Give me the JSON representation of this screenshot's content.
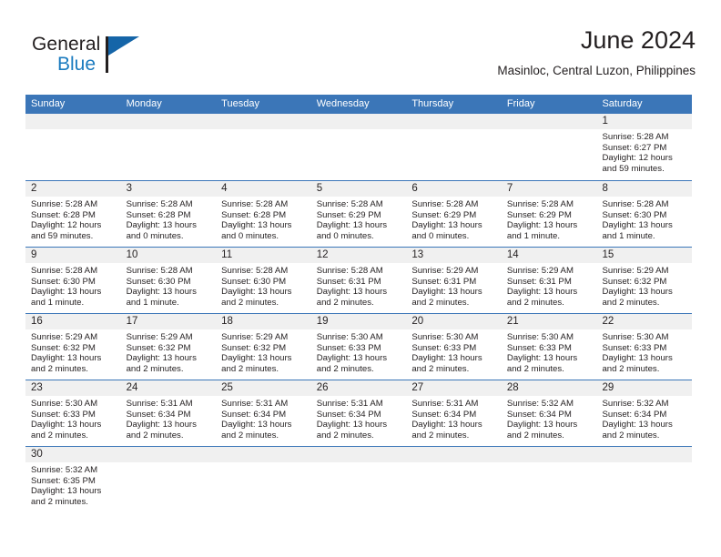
{
  "brand": {
    "name_top": "General",
    "name_bottom": "Blue",
    "accent_color": "#1b7bbf",
    "flag_color": "#1565a8"
  },
  "header": {
    "title": "June 2024",
    "subtitle": "Masinloc, Central Luzon, Philippines"
  },
  "theme": {
    "header_blue": "#3b76b8",
    "day_strip_gray": "#f0f0f0",
    "text_color": "#231f20"
  },
  "calendar": {
    "day_names": [
      "Sunday",
      "Monday",
      "Tuesday",
      "Wednesday",
      "Thursday",
      "Friday",
      "Saturday"
    ],
    "weeks": [
      [
        {
          "day": "",
          "lines": [],
          "empty": true
        },
        {
          "day": "",
          "lines": [],
          "empty": true
        },
        {
          "day": "",
          "lines": [],
          "empty": true
        },
        {
          "day": "",
          "lines": [],
          "empty": true
        },
        {
          "day": "",
          "lines": [],
          "empty": true
        },
        {
          "day": "",
          "lines": [],
          "empty": true
        },
        {
          "day": "1",
          "lines": [
            "Sunrise: 5:28 AM",
            "Sunset: 6:27 PM",
            "Daylight: 12 hours",
            "and 59 minutes."
          ],
          "empty": false
        }
      ],
      [
        {
          "day": "2",
          "lines": [
            "Sunrise: 5:28 AM",
            "Sunset: 6:28 PM",
            "Daylight: 12 hours",
            "and 59 minutes."
          ],
          "empty": false
        },
        {
          "day": "3",
          "lines": [
            "Sunrise: 5:28 AM",
            "Sunset: 6:28 PM",
            "Daylight: 13 hours",
            "and 0 minutes."
          ],
          "empty": false
        },
        {
          "day": "4",
          "lines": [
            "Sunrise: 5:28 AM",
            "Sunset: 6:28 PM",
            "Daylight: 13 hours",
            "and 0 minutes."
          ],
          "empty": false
        },
        {
          "day": "5",
          "lines": [
            "Sunrise: 5:28 AM",
            "Sunset: 6:29 PM",
            "Daylight: 13 hours",
            "and 0 minutes."
          ],
          "empty": false
        },
        {
          "day": "6",
          "lines": [
            "Sunrise: 5:28 AM",
            "Sunset: 6:29 PM",
            "Daylight: 13 hours",
            "and 0 minutes."
          ],
          "empty": false
        },
        {
          "day": "7",
          "lines": [
            "Sunrise: 5:28 AM",
            "Sunset: 6:29 PM",
            "Daylight: 13 hours",
            "and 1 minute."
          ],
          "empty": false
        },
        {
          "day": "8",
          "lines": [
            "Sunrise: 5:28 AM",
            "Sunset: 6:30 PM",
            "Daylight: 13 hours",
            "and 1 minute."
          ],
          "empty": false
        }
      ],
      [
        {
          "day": "9",
          "lines": [
            "Sunrise: 5:28 AM",
            "Sunset: 6:30 PM",
            "Daylight: 13 hours",
            "and 1 minute."
          ],
          "empty": false
        },
        {
          "day": "10",
          "lines": [
            "Sunrise: 5:28 AM",
            "Sunset: 6:30 PM",
            "Daylight: 13 hours",
            "and 1 minute."
          ],
          "empty": false
        },
        {
          "day": "11",
          "lines": [
            "Sunrise: 5:28 AM",
            "Sunset: 6:30 PM",
            "Daylight: 13 hours",
            "and 2 minutes."
          ],
          "empty": false
        },
        {
          "day": "12",
          "lines": [
            "Sunrise: 5:28 AM",
            "Sunset: 6:31 PM",
            "Daylight: 13 hours",
            "and 2 minutes."
          ],
          "empty": false
        },
        {
          "day": "13",
          "lines": [
            "Sunrise: 5:29 AM",
            "Sunset: 6:31 PM",
            "Daylight: 13 hours",
            "and 2 minutes."
          ],
          "empty": false
        },
        {
          "day": "14",
          "lines": [
            "Sunrise: 5:29 AM",
            "Sunset: 6:31 PM",
            "Daylight: 13 hours",
            "and 2 minutes."
          ],
          "empty": false
        },
        {
          "day": "15",
          "lines": [
            "Sunrise: 5:29 AM",
            "Sunset: 6:32 PM",
            "Daylight: 13 hours",
            "and 2 minutes."
          ],
          "empty": false
        }
      ],
      [
        {
          "day": "16",
          "lines": [
            "Sunrise: 5:29 AM",
            "Sunset: 6:32 PM",
            "Daylight: 13 hours",
            "and 2 minutes."
          ],
          "empty": false
        },
        {
          "day": "17",
          "lines": [
            "Sunrise: 5:29 AM",
            "Sunset: 6:32 PM",
            "Daylight: 13 hours",
            "and 2 minutes."
          ],
          "empty": false
        },
        {
          "day": "18",
          "lines": [
            "Sunrise: 5:29 AM",
            "Sunset: 6:32 PM",
            "Daylight: 13 hours",
            "and 2 minutes."
          ],
          "empty": false
        },
        {
          "day": "19",
          "lines": [
            "Sunrise: 5:30 AM",
            "Sunset: 6:33 PM",
            "Daylight: 13 hours",
            "and 2 minutes."
          ],
          "empty": false
        },
        {
          "day": "20",
          "lines": [
            "Sunrise: 5:30 AM",
            "Sunset: 6:33 PM",
            "Daylight: 13 hours",
            "and 2 minutes."
          ],
          "empty": false
        },
        {
          "day": "21",
          "lines": [
            "Sunrise: 5:30 AM",
            "Sunset: 6:33 PM",
            "Daylight: 13 hours",
            "and 2 minutes."
          ],
          "empty": false
        },
        {
          "day": "22",
          "lines": [
            "Sunrise: 5:30 AM",
            "Sunset: 6:33 PM",
            "Daylight: 13 hours",
            "and 2 minutes."
          ],
          "empty": false
        }
      ],
      [
        {
          "day": "23",
          "lines": [
            "Sunrise: 5:30 AM",
            "Sunset: 6:33 PM",
            "Daylight: 13 hours",
            "and 2 minutes."
          ],
          "empty": false
        },
        {
          "day": "24",
          "lines": [
            "Sunrise: 5:31 AM",
            "Sunset: 6:34 PM",
            "Daylight: 13 hours",
            "and 2 minutes."
          ],
          "empty": false
        },
        {
          "day": "25",
          "lines": [
            "Sunrise: 5:31 AM",
            "Sunset: 6:34 PM",
            "Daylight: 13 hours",
            "and 2 minutes."
          ],
          "empty": false
        },
        {
          "day": "26",
          "lines": [
            "Sunrise: 5:31 AM",
            "Sunset: 6:34 PM",
            "Daylight: 13 hours",
            "and 2 minutes."
          ],
          "empty": false
        },
        {
          "day": "27",
          "lines": [
            "Sunrise: 5:31 AM",
            "Sunset: 6:34 PM",
            "Daylight: 13 hours",
            "and 2 minutes."
          ],
          "empty": false
        },
        {
          "day": "28",
          "lines": [
            "Sunrise: 5:32 AM",
            "Sunset: 6:34 PM",
            "Daylight: 13 hours",
            "and 2 minutes."
          ],
          "empty": false
        },
        {
          "day": "29",
          "lines": [
            "Sunrise: 5:32 AM",
            "Sunset: 6:34 PM",
            "Daylight: 13 hours",
            "and 2 minutes."
          ],
          "empty": false
        }
      ],
      [
        {
          "day": "30",
          "lines": [
            "Sunrise: 5:32 AM",
            "Sunset: 6:35 PM",
            "Daylight: 13 hours",
            "and 2 minutes."
          ],
          "empty": false
        },
        {
          "day": "",
          "lines": [],
          "empty": true
        },
        {
          "day": "",
          "lines": [],
          "empty": true
        },
        {
          "day": "",
          "lines": [],
          "empty": true
        },
        {
          "day": "",
          "lines": [],
          "empty": true
        },
        {
          "day": "",
          "lines": [],
          "empty": true
        },
        {
          "day": "",
          "lines": [],
          "empty": true
        }
      ]
    ]
  }
}
